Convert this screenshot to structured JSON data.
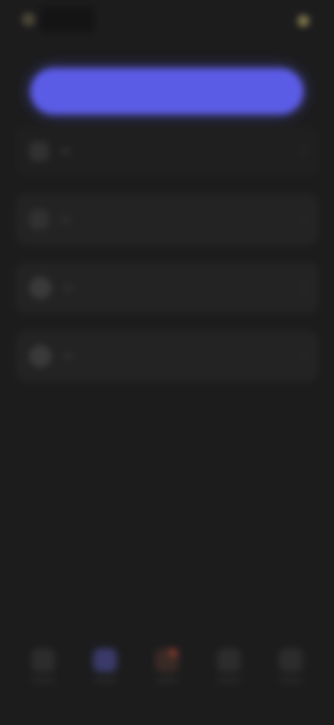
{
  "header": {
    "logo_text": "",
    "balance": ""
  },
  "cta": {
    "label": ""
  },
  "menu": [
    {
      "label": "",
      "icon": "document-icon"
    },
    {
      "label": "",
      "icon": "list-icon"
    },
    {
      "label": "",
      "icon": "profile-icon"
    },
    {
      "label": "",
      "icon": "settings-icon"
    }
  ],
  "bottom_nav": [
    {
      "label": "",
      "icon": "home-icon",
      "state": "default"
    },
    {
      "label": "",
      "icon": "discover-icon",
      "state": "active"
    },
    {
      "label": "",
      "icon": "notifications-icon",
      "state": "alert"
    },
    {
      "label": "",
      "icon": "chat-icon",
      "state": "default"
    },
    {
      "label": "",
      "icon": "account-icon",
      "state": "default"
    }
  ],
  "colors": {
    "background": "#1c1c1d",
    "accent": "#5b5ce6",
    "gold": "#a59c6e",
    "alert": "#8a3a2c"
  }
}
